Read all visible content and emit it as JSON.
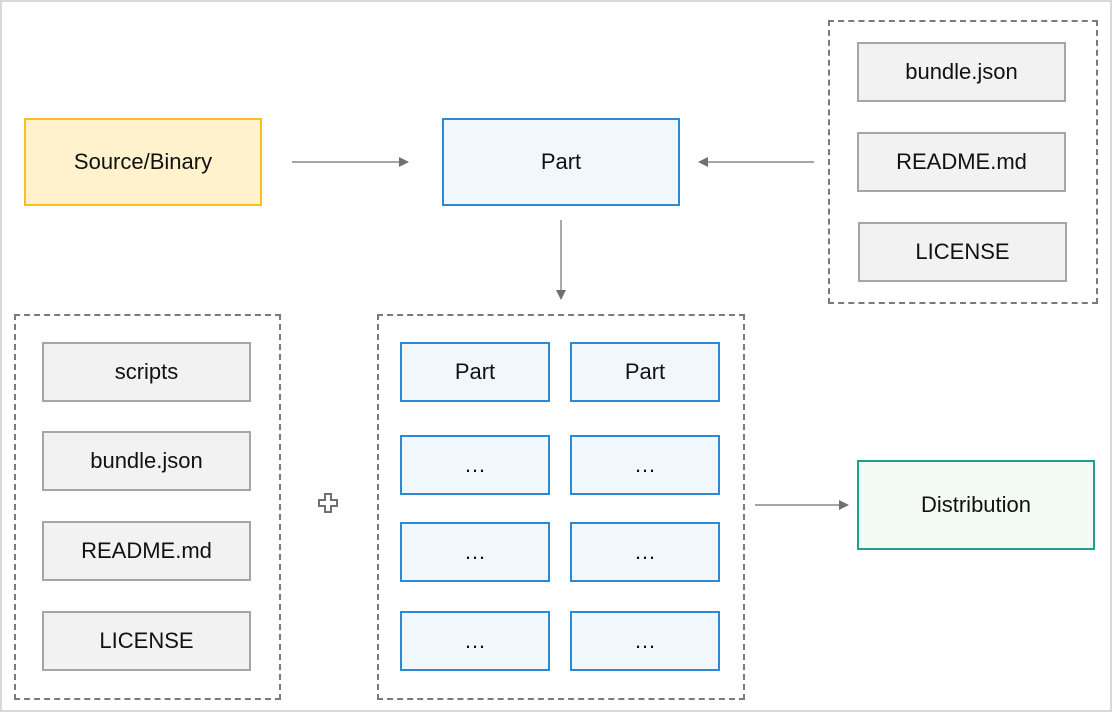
{
  "diagram": {
    "source": {
      "label": "Source/Binary",
      "color": "#f5c21a",
      "fill": "#fff2cc"
    },
    "part": {
      "label": "Part",
      "color": "#2d88d6",
      "fill": "#f0f8fd"
    },
    "part_metadata": {
      "items": [
        "bundle.json",
        "README.md",
        "LICENSE"
      ]
    },
    "distribution_metadata": {
      "items": [
        "scripts",
        "bundle.json",
        "README.md",
        "LICENSE"
      ]
    },
    "plus_icon": "plus-icon",
    "parts_grid": {
      "items": [
        "Part",
        "Part",
        "…",
        "…",
        "…",
        "…",
        "…",
        "…"
      ]
    },
    "distribution": {
      "label": "Distribution",
      "color": "#1aa28a",
      "fill": "#f3f9f4"
    }
  }
}
